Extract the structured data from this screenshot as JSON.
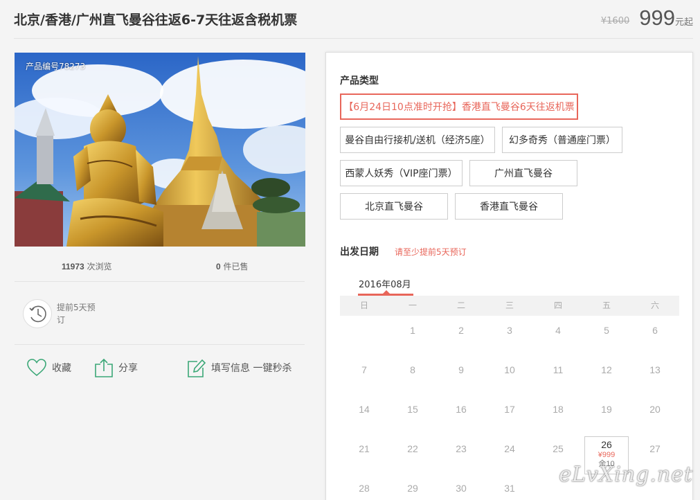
{
  "header": {
    "title": "北京/香港/广州直飞曼谷往返6-7天往返含税机票",
    "old_price": "¥1600",
    "price": "999",
    "price_unit": "元起"
  },
  "product": {
    "product_no": "产品编号78273",
    "views_count": "11973",
    "views_label": "次浏览",
    "sold_count": "0",
    "sold_label": "件已售",
    "advance_notice": "提前5天预订"
  },
  "actions": {
    "favorite": "收藏",
    "share": "分享",
    "fill_info": "填写信息 一键秒杀"
  },
  "product_type": {
    "title": "产品类型",
    "options": [
      "【6月24日10点准时开抢】香港直飞曼谷6天往返机票",
      "曼谷自由行接机/送机（经济5座）",
      "幻多奇秀（普通座门票）",
      "西蒙人妖秀（VIP座门票）",
      "广州直飞曼谷",
      "北京直飞曼谷",
      "香港直飞曼谷"
    ],
    "selected_index": 0
  },
  "departure": {
    "title": "出发日期",
    "hint": "请至少提前5天预订",
    "month": "2016年08月",
    "weekdays": [
      "日",
      "一",
      "二",
      "三",
      "四",
      "五",
      "六"
    ],
    "days": [
      [
        "",
        "1",
        "2",
        "3",
        "4",
        "5",
        "6"
      ],
      [
        "7",
        "8",
        "9",
        "10",
        "11",
        "12",
        "13"
      ],
      [
        "14",
        "15",
        "16",
        "17",
        "18",
        "19",
        "20"
      ],
      [
        "21",
        "22",
        "23",
        "24",
        "25",
        "26",
        "27"
      ],
      [
        "28",
        "29",
        "30",
        "31",
        "",
        "",
        ""
      ]
    ],
    "available": {
      "day": "26",
      "price": "¥999",
      "remaining": "余10"
    }
  },
  "watermark": "eLvXing.net",
  "colors": {
    "accent": "#e8665a",
    "icon_green": "#3aa776"
  }
}
